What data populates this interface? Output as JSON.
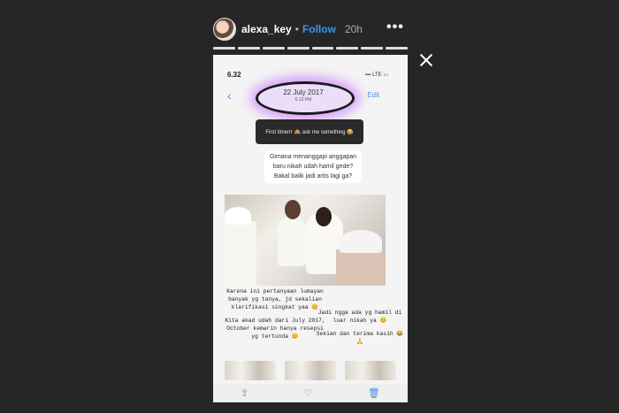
{
  "header": {
    "username": "alexa_key",
    "separator": "•",
    "follow_label": "Follow",
    "time_ago": "20h",
    "more_label": "•••"
  },
  "progress_segments": 8,
  "screenshot": {
    "status_time": "6.32",
    "status_icons": "▪▪▪ LTE ▭",
    "back_label": "‹",
    "edit_label": "Edit",
    "date": "22 July 2017",
    "date_time": "6.13 PM",
    "question_box": "First timerrr 🙈 ask me something 😂",
    "answer_lines": [
      "Gimana menanggapi anggapan",
      "baru nikah udah hamil gede?",
      "Bakal balik jadi artis lagi ga?"
    ],
    "left_note": [
      "Karena ini pertanyaan lumayan banyak yg tanya, jd sekalian klarifikasi singkat yaa 😊",
      "Kita akad udah dari July 2017, October kemarin hanya resepsi yg tertunda 😊"
    ],
    "right_note": [
      "Jadi ngga ada yg hamil di luar nikah ya 😊",
      "Sekian dan terima kasih 😂🙏"
    ]
  },
  "colors": {
    "accent": "#3897f0",
    "highlight": "#be5aff",
    "background": "#262626"
  },
  "icons": {
    "close": "close-icon",
    "more": "more-icon",
    "share": "share-icon",
    "heart": "heart-icon",
    "trash": "trash-icon"
  }
}
